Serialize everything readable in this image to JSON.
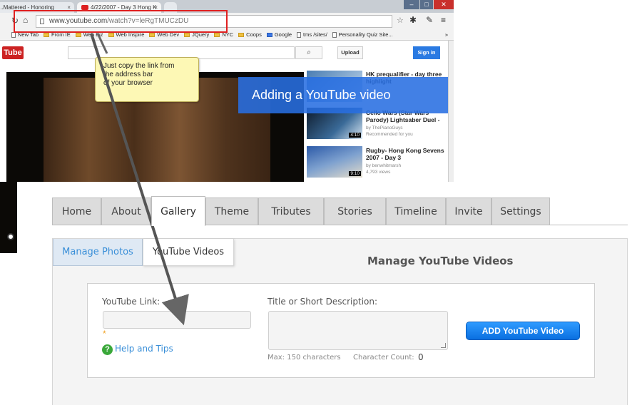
{
  "browser": {
    "tabs": [
      "...Mattered - Honoring",
      "4/22/2007 - Day 3 Hong K"
    ],
    "url_host": "www.youtube.com",
    "url_path": "/watch?v=leRgTMUCzDU",
    "bookmarks": [
      "New Tab",
      "From IE",
      "Web Biz",
      "Web Inspire",
      "Web Dev",
      "JQuery",
      "NYC",
      "Coops",
      "Google",
      "tms /sites/",
      "Personality Quiz Site..."
    ],
    "bookmark_kinds": [
      "page",
      "folder",
      "folder",
      "folder",
      "folder",
      "folder",
      "folder",
      "folder",
      "google",
      "page",
      "page"
    ],
    "overflow": "»"
  },
  "youtube": {
    "logo": "Tube",
    "search_icon": "search-icon",
    "upload": "Upload",
    "signin": "Sign in",
    "related": [
      {
        "title": "HK prequalifier - day three highlight",
        "meta": "",
        "duration": ""
      },
      {
        "title": "Cello Wars (Star Wars Parody) Lightsaber Duel -",
        "meta": "by ThePianoGuys",
        "meta2": "Recommended for you",
        "duration": "4:10"
      },
      {
        "title": "Rugby- Hong Kong Sevens 2007 - Day 3",
        "meta": "by benwhitmarsh",
        "meta2": "4,793 views",
        "duration": "9:10"
      }
    ]
  },
  "annotations": {
    "callout": [
      "Just copy the link from",
      "the address bar",
      "of your browser"
    ],
    "banner": "Adding a YouTube video"
  },
  "app": {
    "nav": [
      "Home",
      "About",
      "Gallery",
      "Theme",
      "Tributes",
      "Stories",
      "Timeline",
      "Invite",
      "Settings"
    ],
    "active_nav": "Gallery",
    "subtabs": [
      "Manage Photos",
      "YouTube Videos"
    ],
    "active_subtab": "YouTube Videos",
    "panel_title": "Manage YouTube Videos",
    "form": {
      "link_label": "YouTube Link:",
      "required_mark": "*",
      "help_link": "Help and Tips",
      "desc_label": "Title or Short Description:",
      "max_chars": "Max: 150 characters",
      "char_count_label": "Character Count:",
      "char_count_value": "0",
      "add_button": "ADD YouTube Video"
    }
  },
  "colors": {
    "accent_blue": "#2a7ae2",
    "highlight_red": "#e02020",
    "link_blue": "#3a8fd8",
    "callout_yellow": "#fdf8b5"
  }
}
